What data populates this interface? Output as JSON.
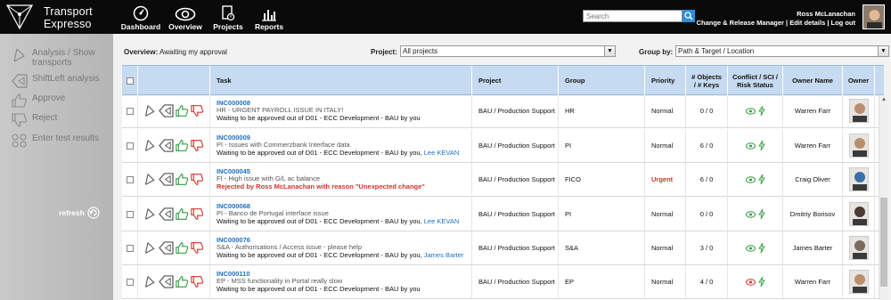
{
  "app": {
    "title_line1": "Transport",
    "title_line2": "Expresso"
  },
  "nav": [
    {
      "label": "Dashboard",
      "icon": "dashboard-icon"
    },
    {
      "label": "Overview",
      "icon": "eye-icon"
    },
    {
      "label": "Projects",
      "icon": "projects-icon"
    },
    {
      "label": "Reports",
      "icon": "reports-icon"
    }
  ],
  "search": {
    "placeholder": "Search"
  },
  "user": {
    "name": "Ross McLanachan",
    "links": "Change & Release Manager | Edit details | Log out"
  },
  "sidebar": {
    "items": [
      {
        "label": "Analysis / Show transports",
        "icon": "analysis-icon"
      },
      {
        "label": "ShiftLeft analysis",
        "icon": "shiftleft-icon"
      },
      {
        "label": "Approve",
        "icon": "thumbs-up-icon"
      },
      {
        "label": "Reject",
        "icon": "thumbs-down-icon"
      },
      {
        "label": "Enter test results",
        "icon": "test-results-icon"
      }
    ],
    "refresh": "refresh"
  },
  "toolbar": {
    "overview_label": "Overview:",
    "overview_value": "Awaiting my approval",
    "project_label": "Project:",
    "project_value": "All projects",
    "groupby_label": "Group by:",
    "groupby_value": "Path & Target / Location"
  },
  "table": {
    "headers": {
      "task": "Task",
      "project": "Project",
      "group": "Group",
      "priority": "Priority",
      "objects_line1": "# Objects",
      "objects_line2": "/ # Keys",
      "conflict_line1": "Conflict / SCI /",
      "conflict_line2": "Risk Status",
      "owner_name": "Owner Name",
      "owner": "Owner"
    },
    "rows": [
      {
        "id": "INC000008",
        "desc": "HR - URGENT PAYROLL ISSUE IN ITALY!",
        "status": "Waiting to be approved out of D01 - ECC Development - BAU by you",
        "extra": "",
        "rejected": false,
        "project": "BAU / Production Support",
        "group": "HR",
        "priority": "Normal",
        "urgent": false,
        "objects": "0 / 0",
        "risk_color": "#2e9e3e",
        "owner": "Warren Farr",
        "avatar": "#b98e6e"
      },
      {
        "id": "INC000009",
        "desc": "PI - Issues with Commerzbank Interface data",
        "status": "Waiting to be approved out of D01 - ECC Development - BAU by you,",
        "extra": "Lee KEVAN",
        "rejected": false,
        "project": "BAU / Production Support",
        "group": "PI",
        "priority": "Normal",
        "urgent": false,
        "objects": "6 / 0",
        "risk_color": "#2e9e3e",
        "owner": "Warren Farr",
        "avatar": "#b98e6e"
      },
      {
        "id": "INC000045",
        "desc": "FI - High issue with G/L ac balance",
        "status": "Rejected by Ross McLanachan with reason \"Unexpected change\"",
        "extra": "",
        "rejected": true,
        "project": "BAU / Production Support",
        "group": "FICO",
        "priority": "Urgent",
        "urgent": true,
        "objects": "6 / 0",
        "risk_color": "#2e9e3e",
        "owner": "Craig Oliver",
        "avatar": "#3d6fa8"
      },
      {
        "id": "INC000068",
        "desc": "PI - Banco de Portugal interface issue",
        "status": "Waiting to be approved out of D01 - ECC Development - BAU by you,",
        "extra": "Lee KEVAN",
        "rejected": false,
        "project": "BAU / Production Support",
        "group": "PI",
        "priority": "Normal",
        "urgent": false,
        "objects": "0 / 0",
        "risk_color": "#2e9e3e",
        "owner": "Dmitriy Borisov",
        "avatar": "#4a3a30"
      },
      {
        "id": "INC000076",
        "desc": "S&A - Authorisations / Access issue - please help",
        "status": "Waiting to be approved out of D01 - ECC Development - BAU by you,",
        "extra": "James Barter",
        "rejected": false,
        "project": "BAU / Production Support",
        "group": "S&A",
        "priority": "Normal",
        "urgent": false,
        "objects": "3 / 0",
        "risk_color": "#2e9e3e",
        "owner": "James Barter",
        "avatar": "#7a6a60"
      },
      {
        "id": "INC000110",
        "desc": "EP - MSS functionality in Portal really slow",
        "status": "Waiting to be approved out of D01 - ECC Development - BAU by you",
        "extra": "",
        "rejected": false,
        "project": "BAU / Production Support",
        "group": "EP",
        "priority": "Normal",
        "urgent": false,
        "objects": "4 / 0",
        "risk_color": "#d4332a",
        "owner": "Warren Farr",
        "avatar": "#b98e6e"
      }
    ]
  }
}
